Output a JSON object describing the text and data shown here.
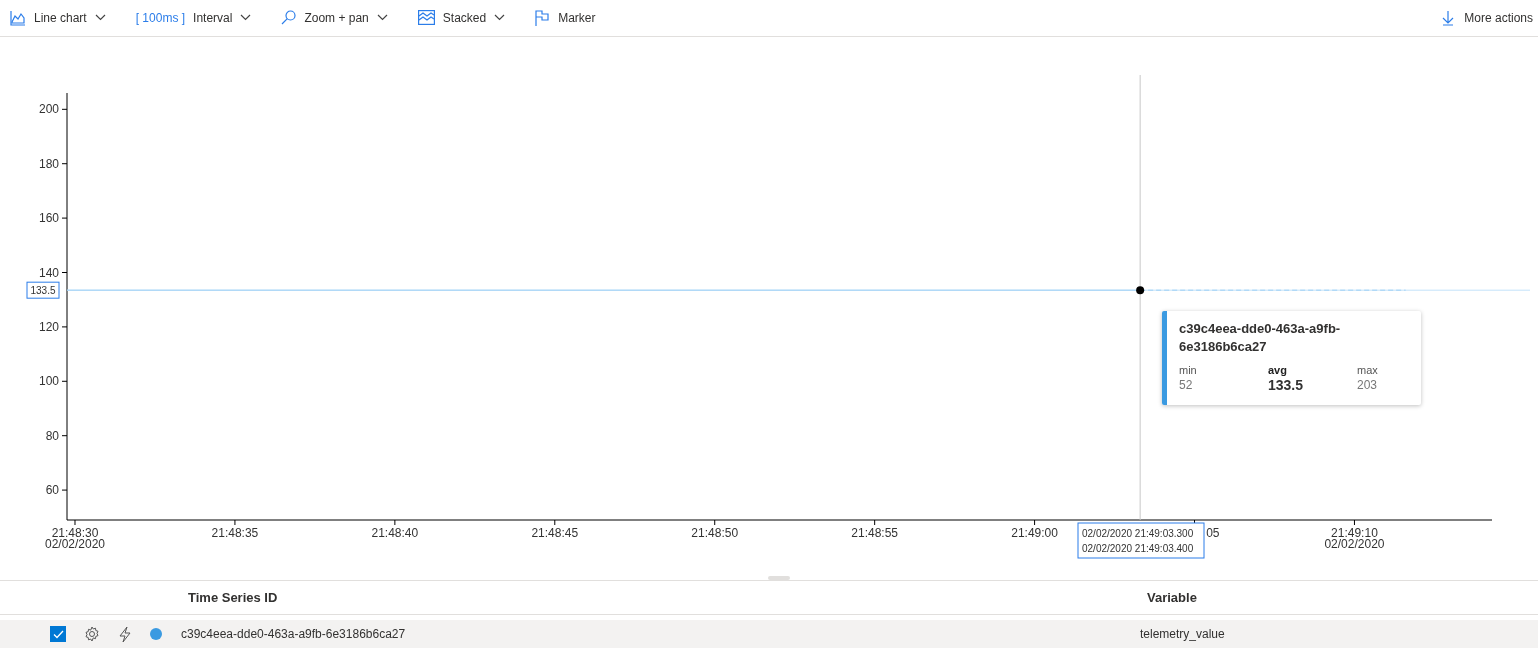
{
  "toolbar": {
    "items": [
      {
        "kind": "chart",
        "label": "Line chart",
        "dropdown": true
      },
      {
        "kind": "interval",
        "prefix": "[ 100ms ]",
        "label": "Interval",
        "dropdown": true
      },
      {
        "kind": "zoom",
        "label": "Zoom + pan",
        "dropdown": true
      },
      {
        "kind": "stacked",
        "label": "Stacked",
        "dropdown": true
      },
      {
        "kind": "marker",
        "label": "Marker",
        "dropdown": false
      }
    ],
    "more_actions": "More actions"
  },
  "chart": {
    "covered_tick_label": "05",
    "hover_y_label": "133.5",
    "hover_x_label": [
      "02/02/2020 21:49:03.300",
      "02/02/2020 21:49:03.400"
    ],
    "chart_data": {
      "type": "line",
      "x": [
        78509.75,
        78543.3,
        78551.6
      ],
      "ref_lines": [
        {
          "axis": "x",
          "value": 78543.3,
          "color": "#c8c8c8"
        },
        {
          "axis": "y",
          "value": 133.5,
          "color": "#c3e2fa"
        }
      ],
      "xlim": [
        78509.75,
        78554.3
      ],
      "ylim": [
        49,
        206
      ],
      "yticks": [
        60,
        80,
        100,
        120,
        140,
        160,
        180,
        200
      ],
      "xticks": [
        {
          "value": 78510,
          "label": "21:48:30 02/02/2020"
        },
        {
          "value": 78515,
          "label": "21:48:35"
        },
        {
          "value": 78520,
          "label": "21:48:40"
        },
        {
          "value": 78525,
          "label": "21:48:45"
        },
        {
          "value": 78530,
          "label": "21:48:50"
        },
        {
          "value": 78535,
          "label": "21:48:55"
        },
        {
          "value": 78540,
          "label": "21:49:00"
        },
        {
          "value": 78550,
          "label": "21:49:10 02/02/2020"
        }
      ],
      "series": [
        {
          "name": "c39c4eea-dde0-463a-a9fb-6e3186b6ca27",
          "color": "#9fd0f5",
          "line_style": "solid",
          "values": [
            133.5,
            133.5,
            null
          ]
        },
        {
          "color": "#9fd0f5",
          "line_style": "dashed",
          "values": [
            null,
            133.5,
            133.5
          ]
        }
      ]
    },
    "tooltip": {
      "color": "#3b9ae1",
      "stats": [
        {
          "label": "min",
          "value": "52",
          "emphasized": false
        },
        {
          "label": "avg",
          "value": "133.5",
          "emphasized": true
        },
        {
          "label": "max",
          "value": "203",
          "emphasized": false
        }
      ]
    }
  },
  "table": {
    "columns": [
      "Time Series ID",
      "Variable"
    ],
    "rows": [
      {
        "checked": true,
        "color": "#3b9ae1",
        "time_series": "c39c4eea-dde0-463a-a9fb-6e3186b6ca27",
        "variable": "telemetry_value"
      }
    ]
  }
}
